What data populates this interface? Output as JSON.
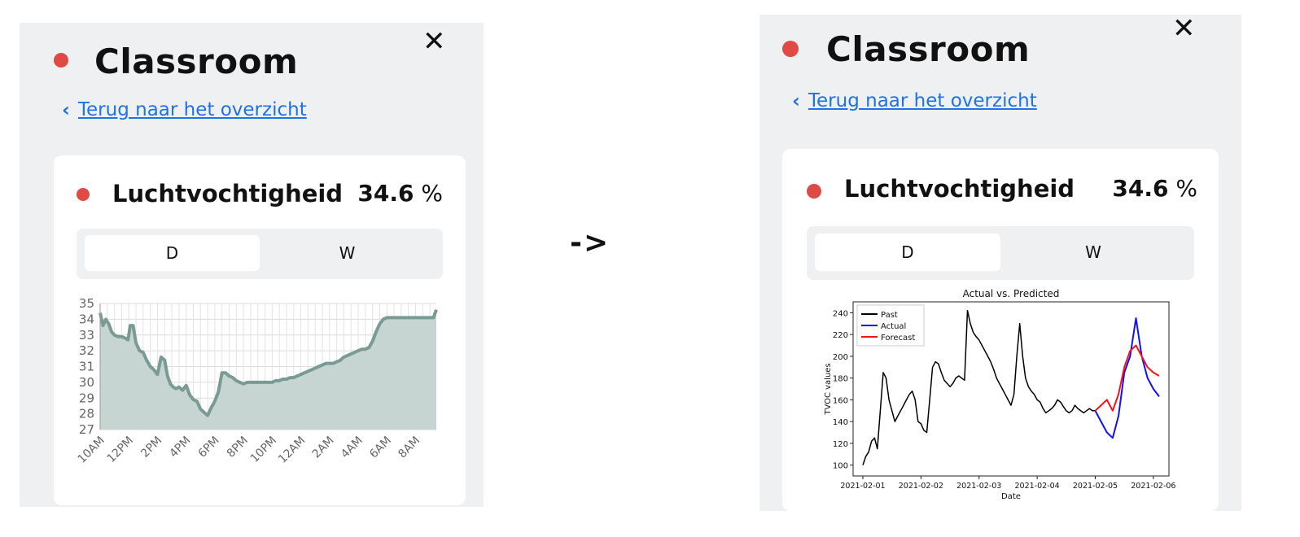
{
  "before": {
    "title": "Classroom",
    "close_label": "✕",
    "back_link": "Terug naar het overzicht",
    "metric": {
      "label": "Luchtvochtigheid",
      "value": "34.6",
      "unit": "%"
    },
    "tabs": [
      {
        "label": "D",
        "active": true
      },
      {
        "label": "W",
        "active": false
      }
    ],
    "status_color": "#e04a44",
    "chart_data": {
      "type": "area",
      "title": "",
      "xlabel": "",
      "ylabel": "",
      "ylim": [
        27,
        35
      ],
      "y_ticks": [
        27,
        28,
        29,
        30,
        31,
        32,
        33,
        34,
        35
      ],
      "x_tick_labels": [
        "10AM",
        "12PM",
        "2PM",
        "4PM",
        "6PM",
        "8PM",
        "10PM",
        "12AM",
        "2AM",
        "4AM",
        "6AM",
        "8AM"
      ],
      "x_hours": [
        0,
        0.4,
        0.8,
        1.2,
        1.6,
        2,
        2.5,
        3,
        3.5,
        3.9,
        4.2,
        4.6,
        5,
        5.5,
        6,
        6.5,
        7,
        7.5,
        8,
        8.5,
        9,
        9.4,
        9.8,
        10.2,
        10.6,
        11,
        11.5,
        12,
        12.5,
        13,
        13.5,
        14,
        14.5,
        15,
        15.5,
        16,
        16.5,
        17,
        17.5,
        18,
        18.5,
        19,
        19.5,
        20,
        20.5,
        21,
        21.5,
        22,
        22.5,
        23,
        23.5,
        24,
        24.5,
        25,
        25.5,
        26,
        26.5,
        27,
        27.5,
        28,
        28.5,
        29,
        29.5,
        30,
        30.5,
        31,
        31.5,
        32,
        32.5,
        33,
        33.5,
        34,
        34.5,
        35,
        35.5,
        36,
        36.5,
        37,
        37.5,
        38,
        38.5,
        39,
        39.5,
        40,
        40.5,
        41,
        41.5,
        42,
        42.5,
        43,
        43.5,
        44,
        44.5,
        45,
        45.5,
        46,
        46.5,
        46.9
      ],
      "series": [
        {
          "values": [
            34.4,
            33.6,
            34.0,
            33.7,
            33.2,
            33.0,
            32.9,
            32.9,
            32.8,
            32.7,
            33.6,
            33.6,
            32.5,
            32.0,
            31.9,
            31.4,
            31.0,
            30.8,
            30.5,
            31.6,
            31.4,
            30.4,
            29.9,
            29.7,
            29.6,
            29.7,
            29.5,
            29.8,
            29.2,
            28.9,
            28.8,
            28.3,
            28.1,
            27.9,
            28.4,
            28.8,
            29.4,
            30.6,
            30.6,
            30.4,
            30.3,
            30.1,
            30.0,
            29.9,
            30.0,
            30.0,
            30.0,
            30.0,
            30.0,
            30.0,
            30.0,
            30.0,
            30.1,
            30.1,
            30.2,
            30.2,
            30.3,
            30.3,
            30.4,
            30.5,
            30.6,
            30.7,
            30.8,
            30.9,
            31.0,
            31.1,
            31.2,
            31.2,
            31.2,
            31.3,
            31.4,
            31.6,
            31.7,
            31.8,
            31.9,
            32.0,
            32.1,
            32.1,
            32.2,
            32.6,
            33.2,
            33.7,
            34.0,
            34.1,
            34.1,
            34.1,
            34.1,
            34.1,
            34.1,
            34.1,
            34.1,
            34.1,
            34.1,
            34.1,
            34.1,
            34.1,
            34.1,
            34.6
          ]
        }
      ],
      "line_color": "#7a9a94",
      "fill_color": "#c6d4d2",
      "grid": true
    }
  },
  "arrow": "->",
  "after": {
    "title": "Classroom",
    "close_label": "✕",
    "back_link": "Terug naar het overzicht",
    "metric": {
      "label": "Luchtvochtigheid",
      "value": "34.6",
      "unit": "%"
    },
    "tabs": [
      {
        "label": "D",
        "active": true
      },
      {
        "label": "W",
        "active": false
      }
    ],
    "status_color": "#e04a44",
    "chart_data": {
      "type": "line",
      "title": "Actual vs. Predicted",
      "xlabel": "Date",
      "ylabel": "TVOC values",
      "ylim": [
        90,
        250
      ],
      "y_ticks": [
        100,
        120,
        140,
        160,
        180,
        200,
        220,
        240
      ],
      "x_tick_labels": [
        "2021-02-01",
        "2021-02-02",
        "2021-02-03",
        "2021-02-04",
        "2021-02-05",
        "2021-02-06"
      ],
      "x_domain_days": [
        0,
        5.1
      ],
      "legend": {
        "placement": "top-left",
        "entries": [
          "Past",
          "Actual",
          "Forecast"
        ]
      },
      "grid": false,
      "series": [
        {
          "name": "Past",
          "color": "#000000",
          "x_days": [
            0,
            0.05,
            0.1,
            0.15,
            0.2,
            0.25,
            0.3,
            0.35,
            0.4,
            0.45,
            0.5,
            0.55,
            0.6,
            0.65,
            0.7,
            0.75,
            0.8,
            0.85,
            0.9,
            0.95,
            1.0,
            1.05,
            1.1,
            1.15,
            1.2,
            1.25,
            1.3,
            1.35,
            1.4,
            1.45,
            1.5,
            1.55,
            1.6,
            1.65,
            1.7,
            1.75,
            1.8,
            1.85,
            1.9,
            1.95,
            2.0,
            2.05,
            2.1,
            2.15,
            2.2,
            2.25,
            2.3,
            2.35,
            2.4,
            2.45,
            2.5,
            2.55,
            2.6,
            2.65,
            2.7,
            2.75,
            2.8,
            2.85,
            2.9,
            2.95,
            3.0,
            3.05,
            3.1,
            3.15,
            3.2,
            3.25,
            3.3,
            3.35,
            3.4,
            3.45,
            3.5,
            3.55,
            3.6,
            3.65,
            3.7,
            3.75,
            3.8,
            3.85,
            3.9,
            3.95,
            4.0
          ],
          "values": [
            100,
            108,
            112,
            122,
            125,
            115,
            150,
            185,
            180,
            160,
            150,
            140,
            145,
            150,
            155,
            160,
            165,
            168,
            160,
            140,
            138,
            132,
            130,
            160,
            190,
            195,
            193,
            185,
            178,
            175,
            172,
            175,
            180,
            182,
            180,
            178,
            242,
            230,
            222,
            218,
            215,
            210,
            205,
            200,
            195,
            188,
            180,
            175,
            170,
            165,
            160,
            155,
            165,
            200,
            230,
            200,
            180,
            172,
            168,
            165,
            160,
            158,
            152,
            148,
            150,
            152,
            155,
            160,
            158,
            154,
            150,
            148,
            150,
            155,
            152,
            150,
            148,
            150,
            152,
            150,
            150
          ]
        },
        {
          "name": "Actual",
          "color": "#1010ff",
          "x_days": [
            4.0,
            4.1,
            4.2,
            4.3,
            4.4,
            4.5,
            4.6,
            4.7,
            4.8,
            4.9,
            5.0,
            5.1
          ],
          "values": [
            150,
            140,
            130,
            125,
            145,
            185,
            200,
            235,
            200,
            180,
            170,
            163
          ]
        },
        {
          "name": "Forecast",
          "color": "#ff1010",
          "x_days": [
            4.0,
            4.1,
            4.2,
            4.3,
            4.4,
            4.5,
            4.6,
            4.7,
            4.8,
            4.9,
            5.0,
            5.1
          ],
          "values": [
            150,
            155,
            160,
            150,
            165,
            190,
            205,
            210,
            200,
            190,
            185,
            182
          ]
        }
      ]
    }
  }
}
